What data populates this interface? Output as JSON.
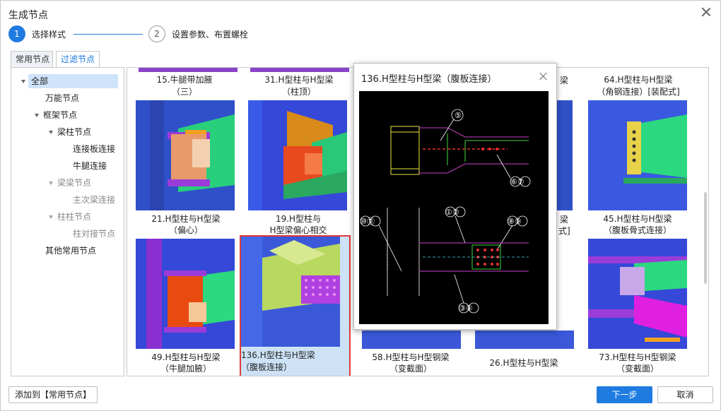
{
  "dialog": {
    "title": "生成节点"
  },
  "steps": [
    {
      "number": "1",
      "label": "选择样式"
    },
    {
      "number": "2",
      "label": "设置参数、布置螺栓"
    }
  ],
  "tabs": [
    {
      "label": "常用节点"
    },
    {
      "label": "过滤节点"
    }
  ],
  "tree": {
    "items": [
      {
        "label": "全部",
        "selected": true
      },
      {
        "label": "万能节点"
      },
      {
        "label": "框架节点"
      },
      {
        "label": "梁柱节点"
      },
      {
        "label": "连接板连接"
      },
      {
        "label": "牛腿连接"
      },
      {
        "label": "梁梁节点"
      },
      {
        "label": "主次梁连接"
      },
      {
        "label": "柱柱节点"
      },
      {
        "label": "柱对接节点"
      },
      {
        "label": "其他常用节点"
      }
    ]
  },
  "cards": [
    {
      "caption1": "15.牛腿带加腋",
      "caption2": "（三）"
    },
    {
      "caption1": "31.H型柱与H型梁",
      "caption2": "（柱顶）"
    },
    {
      "caption1": "64.H型柱与H型梁",
      "caption2": "（角钢连接）[装配式]"
    },
    {
      "caption1": "21.H型柱与H型梁",
      "caption2": "（偏心）"
    },
    {
      "caption1": "19.H型柱与",
      "caption2": "H型梁偏心相交"
    },
    {
      "caption1": "45.H型柱与H型梁",
      "caption2": "（腹板骨式连接）"
    },
    {
      "caption1": "49.H型柱与H型梁",
      "caption2": "（牛腿加腋）"
    },
    {
      "caption1": "136.H型柱与H型梁",
      "caption2": "（腹板连接）"
    },
    {
      "caption1": "58.H型柱与H型钢梁",
      "caption2": "（变截面）"
    },
    {
      "caption1": "26.H型柱与H型梁",
      "caption2": ""
    },
    {
      "caption1": "73.H型柱与H型钢梁",
      "caption2": "（变截面）"
    }
  ],
  "hidden_fragments": {
    "row1_col4": "梁",
    "row2_col3": "梁",
    "row2_col4": "式]"
  },
  "popup": {
    "title": "136.H型柱与H型梁（腹板连接）",
    "labels": [
      "⑤",
      "⑥⑦",
      "⑩⑪",
      "①②",
      "⑧⑨",
      "③④"
    ]
  },
  "footer": {
    "add_label": "添加到【常用节点】",
    "next_label": "下一步",
    "cancel_label": "取消"
  },
  "colors": {
    "accent": "#1f7be0",
    "selected_border": "#e03a3a",
    "selected_bg": "#cde2f7"
  }
}
